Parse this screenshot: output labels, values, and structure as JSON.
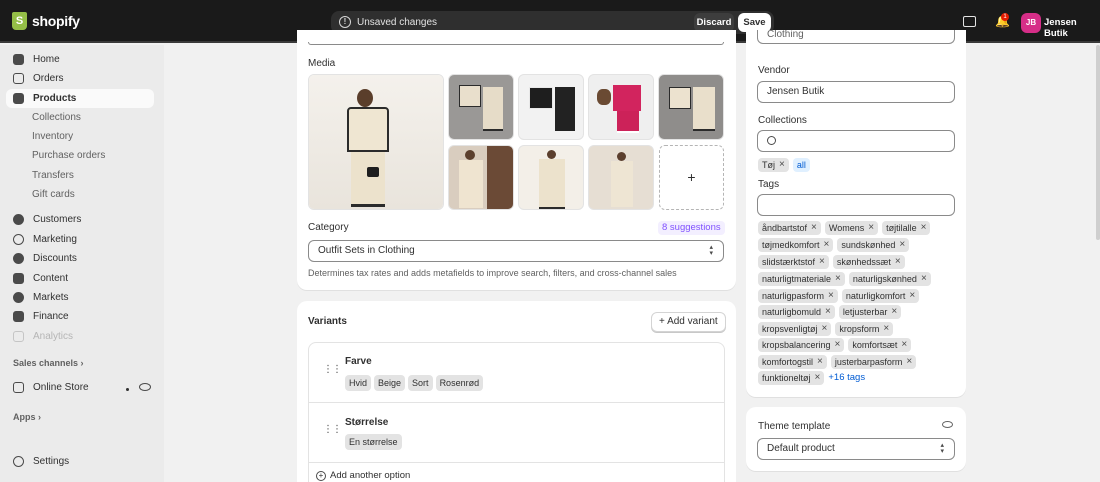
{
  "topbar": {
    "logo": "shopify",
    "unsaved_text": "Unsaved changes",
    "discard_label": "Discard",
    "save_label": "Save",
    "notification_count": "1",
    "avatar_initials": "JB",
    "user_name": "Jensen Butik"
  },
  "sidebar": {
    "items": [
      {
        "label": "Home",
        "icon": "home-icon"
      },
      {
        "label": "Orders",
        "icon": "orders-icon"
      },
      {
        "label": "Products",
        "icon": "tag-icon"
      },
      {
        "label": "Collections"
      },
      {
        "label": "Inventory"
      },
      {
        "label": "Purchase orders"
      },
      {
        "label": "Transfers"
      },
      {
        "label": "Gift cards"
      },
      {
        "label": "Customers",
        "icon": "person-icon"
      },
      {
        "label": "Marketing",
        "icon": "target-icon"
      },
      {
        "label": "Discounts",
        "icon": "discount-icon"
      },
      {
        "label": "Content",
        "icon": "content-icon"
      },
      {
        "label": "Markets",
        "icon": "globe-icon"
      },
      {
        "label": "Finance",
        "icon": "bank-icon"
      },
      {
        "label": "Analytics",
        "icon": "chart-icon"
      }
    ],
    "sales_channels_label": "Sales channels",
    "online_store_label": "Online Store",
    "apps_label": "Apps",
    "settings_label": "Settings"
  },
  "media": {
    "title": "Media"
  },
  "category": {
    "label": "Category",
    "suggestions": "8 suggestions",
    "value": "Outfit Sets in Clothing",
    "help": "Determines tax rates and adds metafields to improve search, filters, and cross-channel sales"
  },
  "variants": {
    "title": "Variants",
    "add_variant_label": "Add variant",
    "options": [
      {
        "name": "Farve",
        "values": [
          "Hvid",
          "Beige",
          "Sort",
          "Rosenrød"
        ]
      },
      {
        "name": "Størrelse",
        "values": [
          "En størrelse"
        ]
      }
    ],
    "add_option_label": "Add another option"
  },
  "organization": {
    "type_value": "Clothing",
    "vendor_label": "Vendor",
    "vendor_value": "Jensen Butik",
    "collections_label": "Collections",
    "collection_chips": [
      "Tøj",
      "all"
    ],
    "tags_label": "Tags",
    "tag_rows": [
      [
        "åndbartstof",
        "Womens",
        "tøjtilalle"
      ],
      [
        "tøjmedkomfort",
        "sundskønhed"
      ],
      [
        "slidstærktstof",
        "skønhedssæt"
      ],
      [
        "naturligtmateriale",
        "naturligskønhed"
      ],
      [
        "naturligpasform",
        "naturligkomfort"
      ],
      [
        "naturligbomuld",
        "letjusterbar"
      ],
      [
        "kropsvenligtøj",
        "kropsform"
      ],
      [
        "kropsbalancering",
        "komfortsæt"
      ],
      [
        "komfortogstil",
        "justerbarpasform"
      ],
      [
        "funktioneltøj"
      ]
    ],
    "more_tags": "+16 tags"
  },
  "theme": {
    "label": "Theme template",
    "value": "Default product"
  },
  "colors": {
    "accent_purple": "#8051ff",
    "avatar_pink": "#d62e88",
    "link_blue": "#005bd3"
  }
}
